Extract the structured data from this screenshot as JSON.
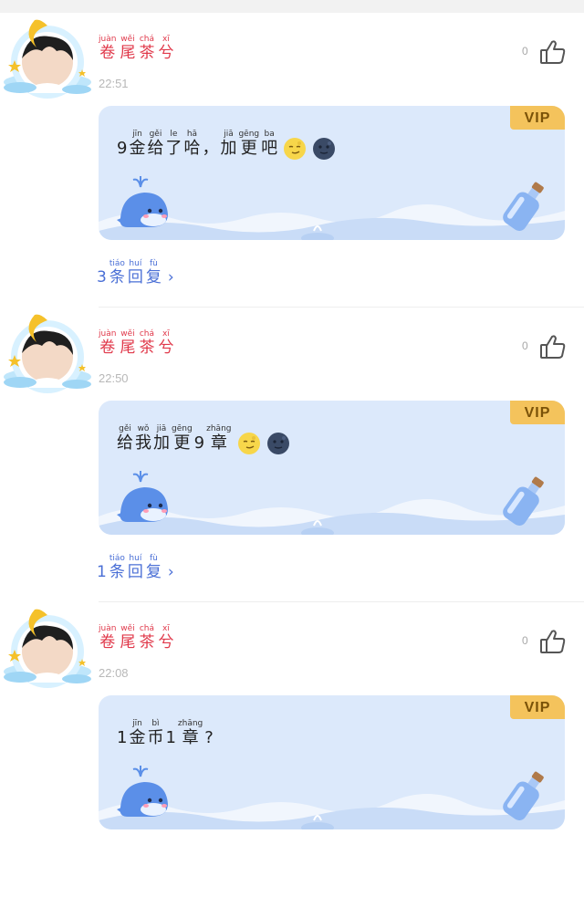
{
  "comments": [
    {
      "username": [
        {
          "py": "juàn",
          "hz": "卷"
        },
        {
          "py": "wěi",
          "hz": "尾"
        },
        {
          "py": "chá",
          "hz": "茶"
        },
        {
          "py": "xī",
          "hz": "兮"
        }
      ],
      "time": "22:51",
      "likes": "0",
      "vip_label": "VIP",
      "message": [
        {
          "py": "",
          "hz": "9"
        },
        {
          "py": "jīn",
          "hz": "金"
        },
        {
          "py": "gěi",
          "hz": "给"
        },
        {
          "py": "le",
          "hz": "了"
        },
        {
          "py": "hā",
          "hz": "哈"
        },
        {
          "py": "",
          "hz": "，"
        },
        {
          "py": "jiā",
          "hz": "加"
        },
        {
          "py": "gēng",
          "hz": "更"
        },
        {
          "py": "ba",
          "hz": "吧"
        }
      ],
      "emojis": [
        "moon-face-icon",
        "new-moon-face-icon"
      ],
      "replies": [
        {
          "py": "",
          "hz": "3"
        },
        {
          "py": "tiáo",
          "hz": "条"
        },
        {
          "py": "huí",
          "hz": "回"
        },
        {
          "py": "fù",
          "hz": "复"
        }
      ]
    },
    {
      "username": [
        {
          "py": "juàn",
          "hz": "卷"
        },
        {
          "py": "wěi",
          "hz": "尾"
        },
        {
          "py": "chá",
          "hz": "茶"
        },
        {
          "py": "xī",
          "hz": "兮"
        }
      ],
      "time": "22:50",
      "likes": "0",
      "vip_label": "VIP",
      "message": [
        {
          "py": "gěi",
          "hz": "给"
        },
        {
          "py": "wǒ",
          "hz": "我"
        },
        {
          "py": "jiā",
          "hz": "加"
        },
        {
          "py": "gēng",
          "hz": "更"
        },
        {
          "py": "",
          "hz": "9"
        },
        {
          "py": "zhāng",
          "hz": "章"
        }
      ],
      "emojis": [
        "moon-face-icon",
        "new-moon-face-icon"
      ],
      "replies": [
        {
          "py": "",
          "hz": "1"
        },
        {
          "py": "tiáo",
          "hz": "条"
        },
        {
          "py": "huí",
          "hz": "回"
        },
        {
          "py": "fù",
          "hz": "复"
        }
      ]
    },
    {
      "username": [
        {
          "py": "juàn",
          "hz": "卷"
        },
        {
          "py": "wěi",
          "hz": "尾"
        },
        {
          "py": "chá",
          "hz": "茶"
        },
        {
          "py": "xī",
          "hz": "兮"
        }
      ],
      "time": "22:08",
      "likes": "0",
      "vip_label": "VIP",
      "message": [
        {
          "py": "",
          "hz": "1"
        },
        {
          "py": "jīn",
          "hz": "金"
        },
        {
          "py": "bì",
          "hz": "币"
        },
        {
          "py": "",
          "hz": "1"
        },
        {
          "py": "zhāng",
          "hz": "章"
        },
        {
          "py": "",
          "hz": "?"
        }
      ],
      "emojis": [],
      "replies": []
    }
  ],
  "icons": {
    "like": "thumbs-up-icon",
    "chevron": "chevron-right-icon"
  },
  "colors": {
    "username": "#e0384a",
    "reply_link": "#4a6fd6",
    "bubble_bg": "#dce9fb",
    "vip_badge": "#f4c35c"
  }
}
